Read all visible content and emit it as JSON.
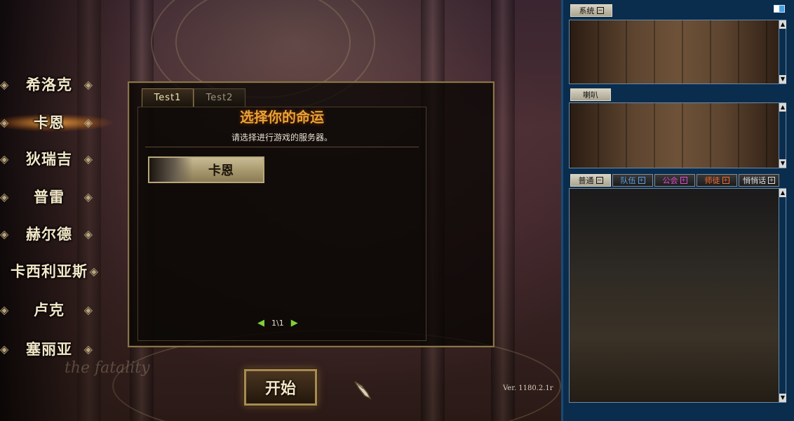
{
  "characters": [
    {
      "name": "希洛克",
      "selected": false
    },
    {
      "name": "卡恩",
      "selected": true
    },
    {
      "name": "狄瑞吉",
      "selected": false
    },
    {
      "name": "普雷",
      "selected": false
    },
    {
      "name": "赫尔德",
      "selected": false
    },
    {
      "name": "卡西利亚斯",
      "selected": false
    },
    {
      "name": "卢克",
      "selected": false
    },
    {
      "name": "塞丽亚",
      "selected": false
    }
  ],
  "server_dialog": {
    "tabs": [
      "Test1",
      "Test2"
    ],
    "active_tab": "Test1",
    "title": "选择你的命运",
    "subtitle": "请选择进行游戏的服务器。",
    "servers": [
      "卡恩"
    ],
    "page": "1\\1"
  },
  "start_button": {
    "label": "开始"
  },
  "background_art": {
    "title": "the fatality"
  },
  "version": "Ver. 1180.2.1r",
  "chat": {
    "system_tab": "系统",
    "horn_tab": "喇叭",
    "channel_tabs": [
      {
        "label": "普通",
        "color": "#111111"
      },
      {
        "label": "队伍",
        "color": "#5aa0e8"
      },
      {
        "label": "公会",
        "color": "#e04ad0"
      },
      {
        "label": "师徒",
        "color": "#ff6a2a"
      },
      {
        "label": "悄悄话",
        "color": "#e0e0e0"
      }
    ]
  },
  "colors": {
    "chat_bg": "#0a2d4e",
    "dialog_border": "#8a7548",
    "title_gold": "#e7a23a",
    "pager_arrow": "#7fd13a"
  }
}
